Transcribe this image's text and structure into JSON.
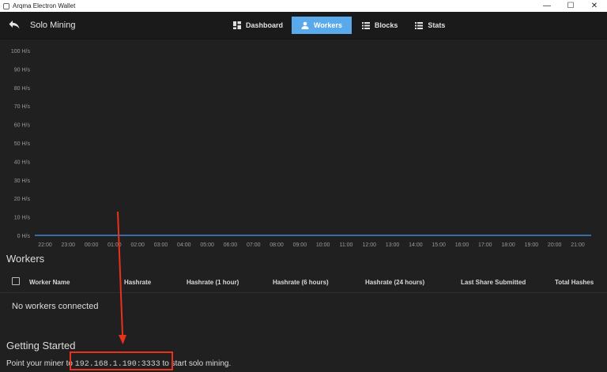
{
  "window": {
    "title": "Arqma Electron Wallet",
    "controls": {
      "minimize": "—",
      "maximize": "☐",
      "close": "✕"
    }
  },
  "header": {
    "title": "Solo Mining",
    "nav": [
      {
        "label": "Dashboard",
        "icon": "dashboard-icon",
        "active": false
      },
      {
        "label": "Workers",
        "icon": "person-icon",
        "active": true
      },
      {
        "label": "Blocks",
        "icon": "list-icon",
        "active": false
      },
      {
        "label": "Stats",
        "icon": "list-icon",
        "active": false
      }
    ]
  },
  "colors": {
    "accent": "#5aa9ea",
    "background": "#202020",
    "line": "#3f87d6",
    "annotation": "#e8321c"
  },
  "chart_data": {
    "type": "line",
    "ylabels": [
      "100 H/s",
      "90 H/s",
      "80 H/s",
      "70 H/s",
      "60 H/s",
      "50 H/s",
      "40 H/s",
      "30 H/s",
      "20 H/s",
      "10 H/s",
      "0 H/s"
    ],
    "x": [
      "22:00",
      "23:00",
      "00:00",
      "01:00",
      "02:00",
      "03:00",
      "04:00",
      "05:00",
      "06:00",
      "07:00",
      "08:00",
      "09:00",
      "10:00",
      "11:00",
      "12:00",
      "13:00",
      "14:00",
      "15:00",
      "16:00",
      "17:00",
      "18:00",
      "19:00",
      "20:00",
      "21:00"
    ],
    "series": [
      {
        "values": [
          0,
          0,
          0,
          0,
          0,
          0,
          0,
          0,
          0,
          0,
          0,
          0,
          0,
          0,
          0,
          0,
          0,
          0,
          0,
          0,
          0,
          0,
          0,
          0
        ]
      }
    ],
    "ylim": [
      0,
      100
    ],
    "grid": false
  },
  "workers": {
    "title": "Workers",
    "columns": [
      "Worker Name",
      "Hashrate",
      "Hashrate (1 hour)",
      "Hashrate (6 hours)",
      "Hashrate (24 hours)",
      "Last Share Submitted",
      "Total Hashes"
    ],
    "empty_message": "No workers connected"
  },
  "getting_started": {
    "title": "Getting Started",
    "prefix": "Point your miner to ",
    "address": "192.168.1.190:3333",
    "suffix": " to start solo mining."
  }
}
